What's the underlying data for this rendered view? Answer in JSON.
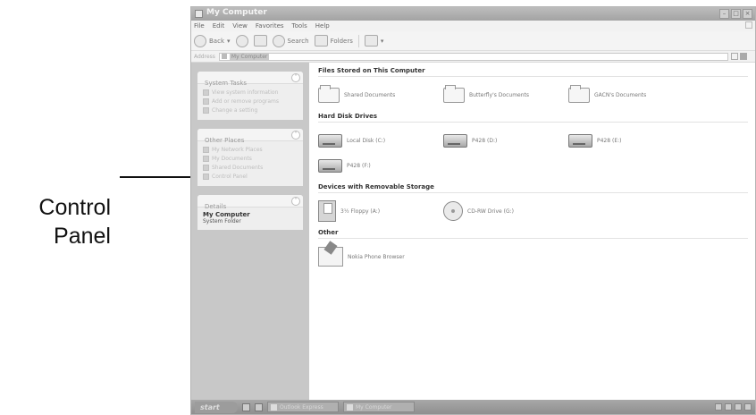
{
  "callout": {
    "line1": "Control",
    "line2": "Panel"
  },
  "window": {
    "title": "My Computer"
  },
  "menu": [
    "File",
    "Edit",
    "View",
    "Favorites",
    "Tools",
    "Help"
  ],
  "toolbar": {
    "back_label": "Back",
    "search_label": "Search",
    "folders_label": "Folders"
  },
  "address": {
    "label": "Address",
    "value": "My Computer",
    "go_label": "Go"
  },
  "sidebar": {
    "system_tasks": {
      "title": "System Tasks",
      "items": [
        "View system information",
        "Add or remove programs",
        "Change a setting"
      ]
    },
    "other_places": {
      "title": "Other Places",
      "items": [
        "My Network Places",
        "My Documents",
        "Shared Documents",
        "Control Panel"
      ]
    },
    "details": {
      "title": "Details",
      "name": "My Computer",
      "type": "System Folder"
    }
  },
  "groups": {
    "stored": {
      "title": "Files Stored on This Computer",
      "items": [
        "Shared Documents",
        "Butterfly's Documents",
        "GACN's Documents"
      ]
    },
    "hdd": {
      "title": "Hard Disk Drives",
      "items": [
        "Local Disk (C:)",
        "P428 (D:)",
        "P428 (E:)",
        "P428 (F:)"
      ]
    },
    "removable": {
      "title": "Devices with Removable Storage",
      "items": [
        "3½ Floppy (A:)",
        "CD-RW Drive (G:)"
      ]
    },
    "other": {
      "title": "Other",
      "items": [
        "Nokia Phone Browser"
      ]
    }
  },
  "taskbar": {
    "start_label": "start",
    "task1": "Outlook Express",
    "task2": "My Computer"
  }
}
